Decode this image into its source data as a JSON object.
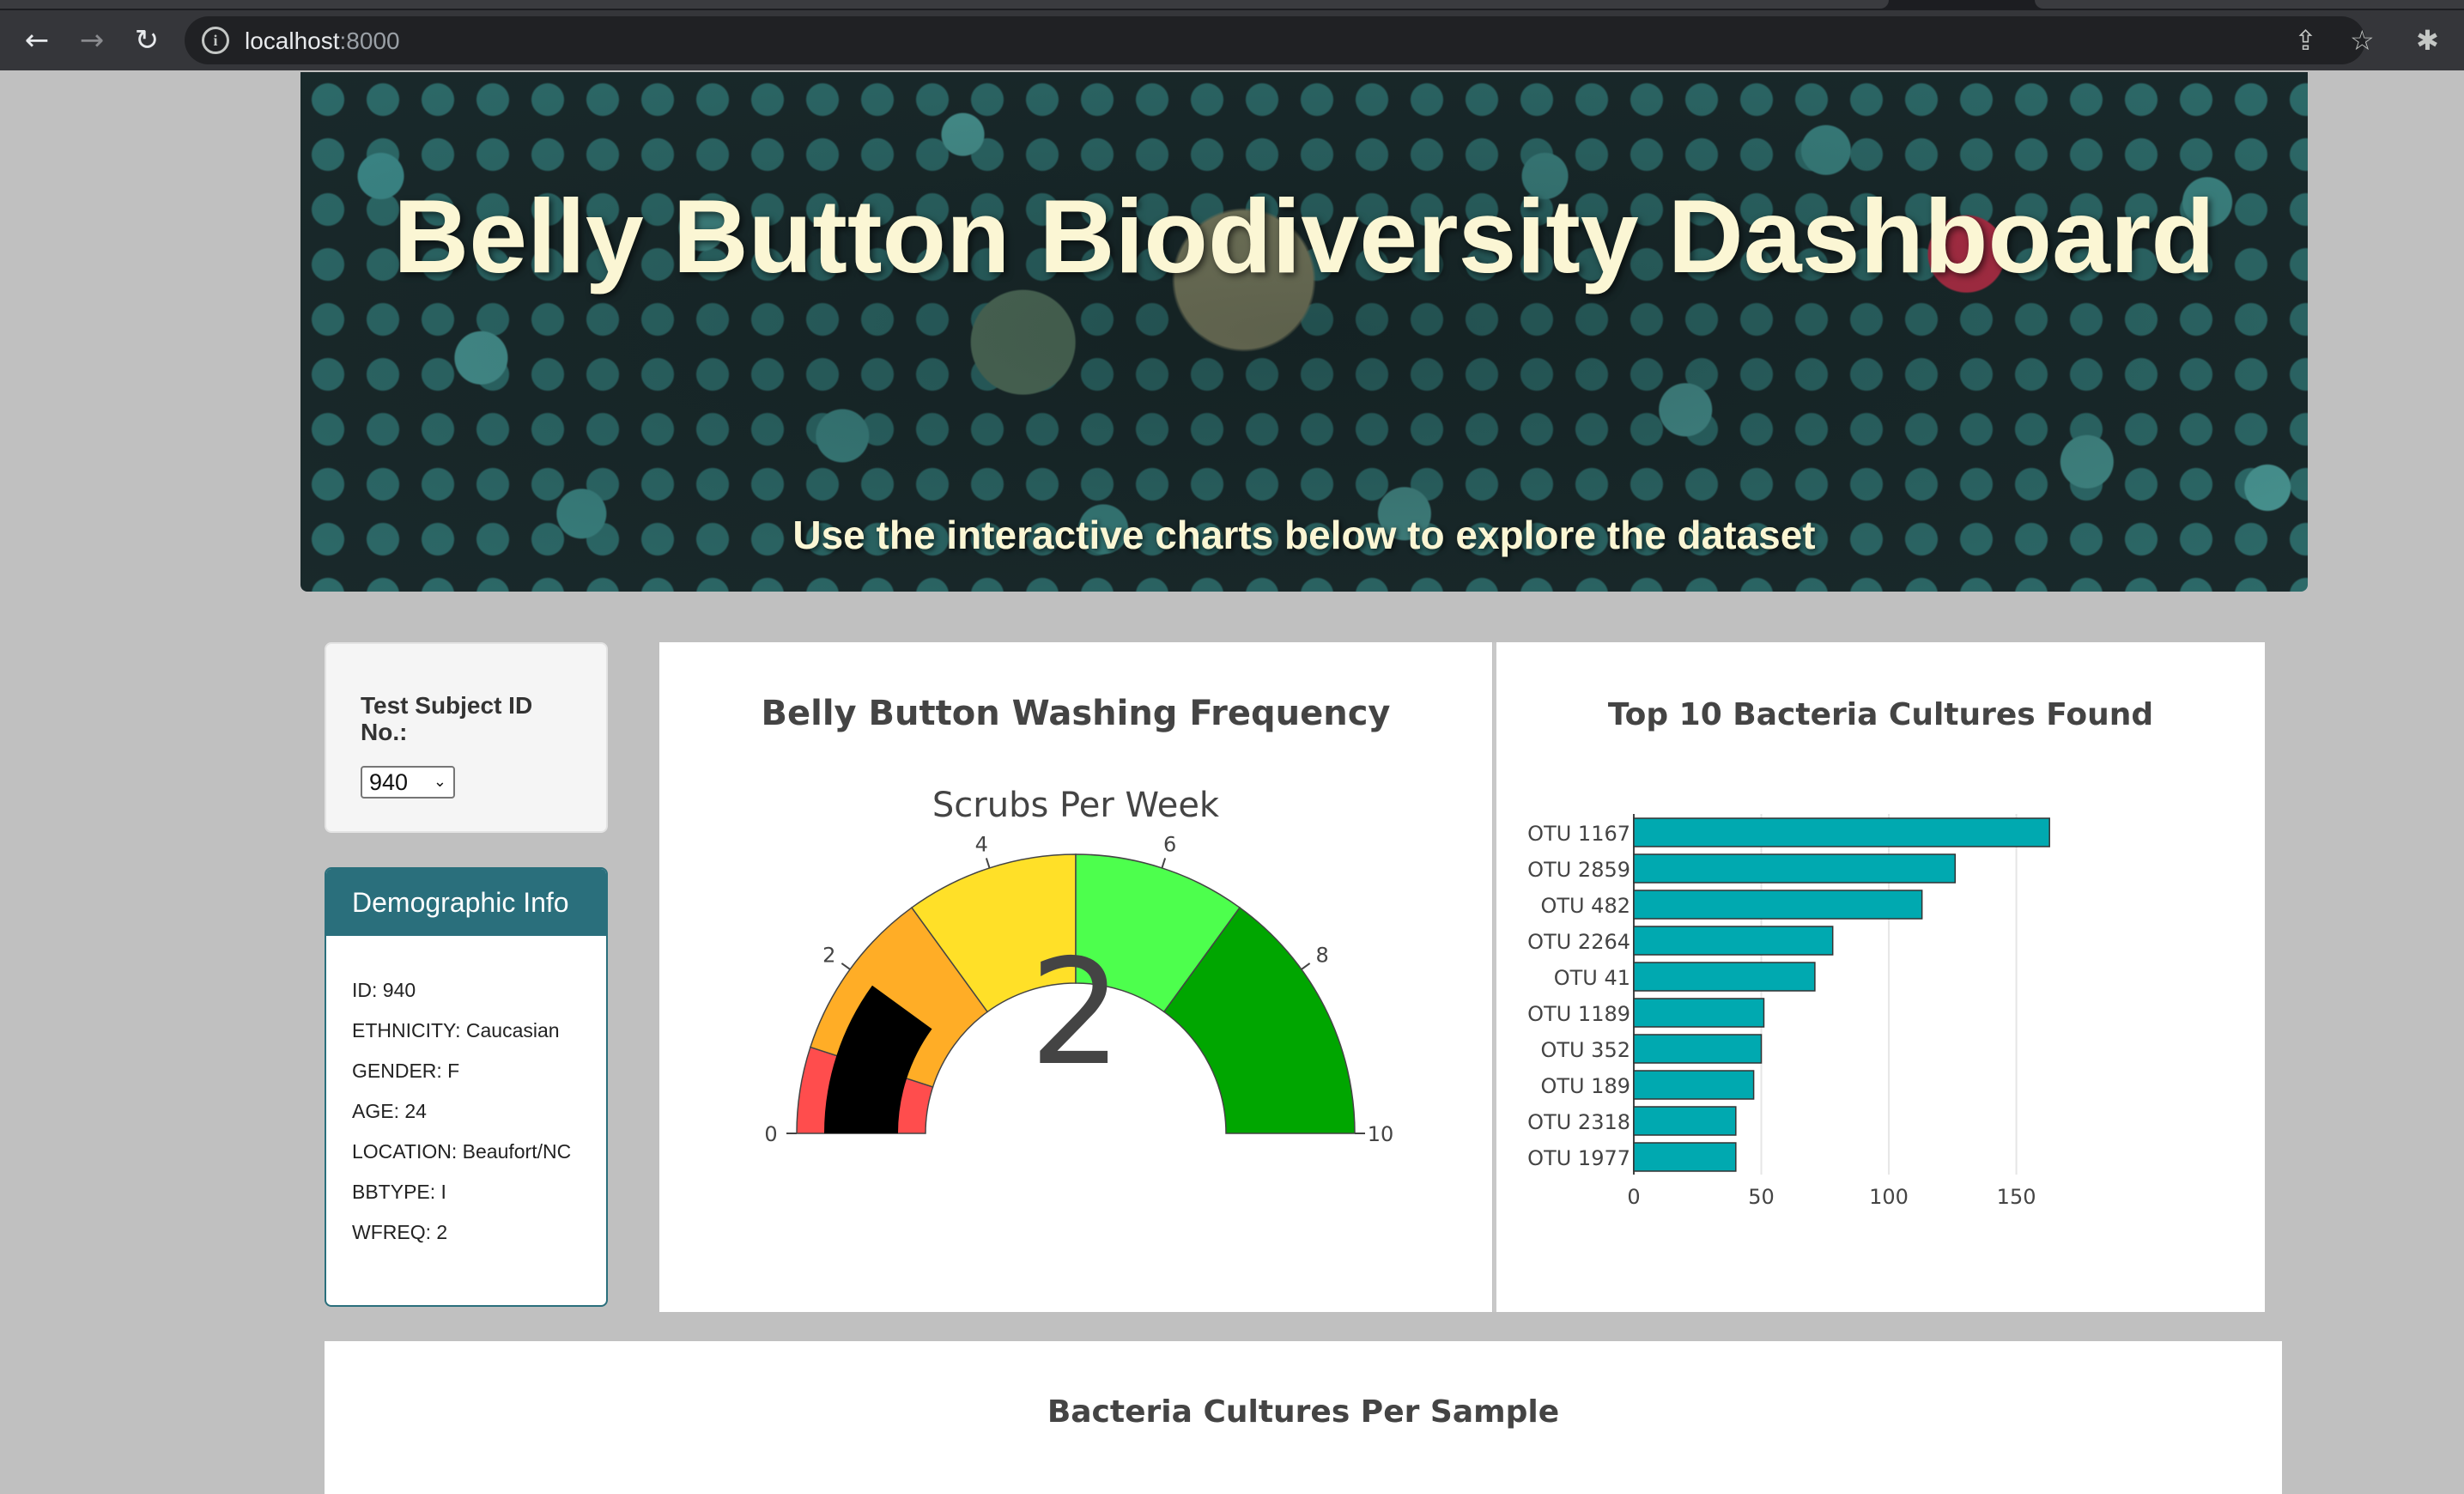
{
  "browser": {
    "url_host": "localhost",
    "url_port": ":8000"
  },
  "header": {
    "title": "Belly Button Biodiversity Dashboard",
    "subtitle": "Use the interactive charts below to explore the dataset"
  },
  "selector": {
    "label": "Test Subject ID No.:",
    "selected": "940"
  },
  "demographic": {
    "title": "Demographic Info",
    "rows": [
      "ID: 940",
      "ETHNICITY: Caucasian",
      "GENDER: F",
      "AGE: 24",
      "LOCATION: Beaufort/NC",
      "BBTYPE: I",
      "WFREQ: 2"
    ]
  },
  "colors": {
    "accent": "#2a6f7c",
    "bar": "#00a9b0",
    "gauge_steps": [
      "#ff4d4d",
      "#ffad26",
      "#ffe028",
      "#4dff4d",
      "#00a600"
    ],
    "needle": "#000000"
  },
  "chart_data": [
    {
      "type": "gauge",
      "title": "Belly Button Washing Frequency",
      "subtitle": "Scrubs Per Week",
      "value": 2,
      "range": [
        0,
        10
      ],
      "ticks": [
        0,
        2,
        4,
        6,
        8,
        10
      ],
      "steps": [
        [
          0,
          1
        ],
        [
          1,
          3
        ],
        [
          3,
          5
        ],
        [
          5,
          7
        ],
        [
          7,
          10
        ]
      ]
    },
    {
      "type": "bar",
      "orientation": "horizontal",
      "title": "Top 10 Bacteria Cultures Found",
      "categories": [
        "OTU 1167",
        "OTU 2859",
        "OTU 482",
        "OTU 2264",
        "OTU 41",
        "OTU 1189",
        "OTU 352",
        "OTU 189",
        "OTU 2318",
        "OTU 1977"
      ],
      "values": [
        163,
        126,
        113,
        78,
        71,
        51,
        50,
        47,
        40,
        40
      ],
      "xlim": [
        0,
        170
      ],
      "xticks": [
        0,
        50,
        100,
        150
      ]
    },
    {
      "type": "scatter",
      "title": "Bacteria Cultures Per Sample"
    }
  ]
}
